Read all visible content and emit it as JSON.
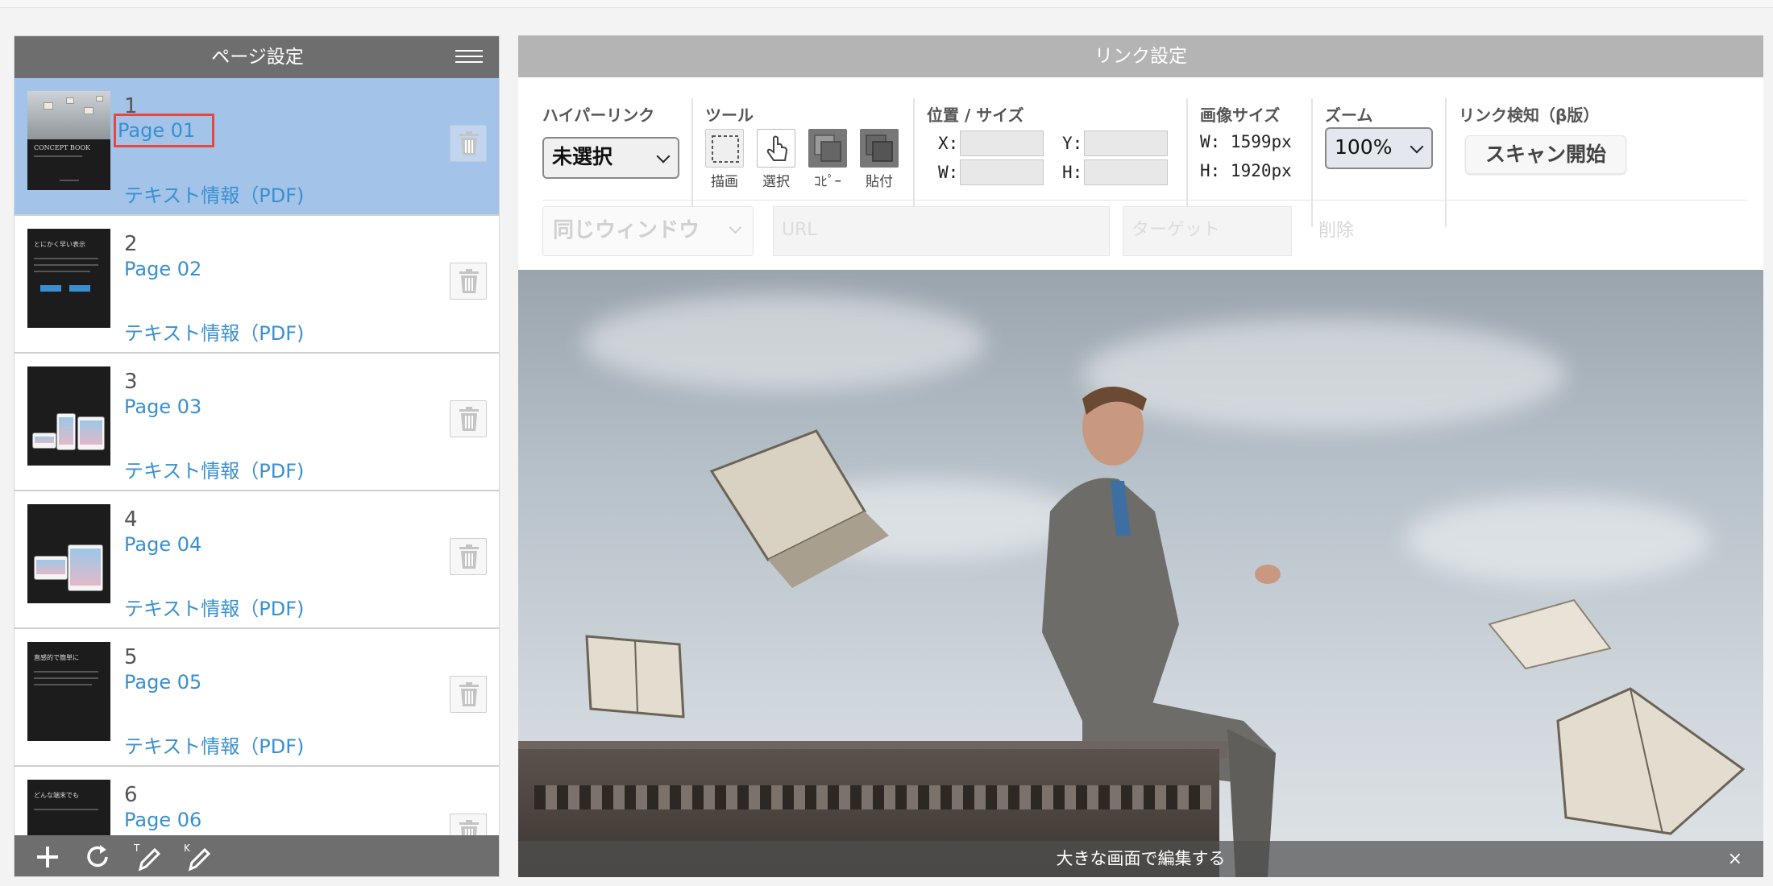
{
  "left_panel": {
    "title": "ページ設定",
    "pages": [
      {
        "number": "1",
        "name": "Page 01",
        "pdf_label": "テキスト情報（PDF)",
        "selected": true
      },
      {
        "number": "2",
        "name": "Page 02",
        "pdf_label": "テキスト情報（PDF)",
        "selected": false
      },
      {
        "number": "3",
        "name": "Page 03",
        "pdf_label": "テキスト情報（PDF)",
        "selected": false
      },
      {
        "number": "4",
        "name": "Page 04",
        "pdf_label": "テキスト情報（PDF)",
        "selected": false
      },
      {
        "number": "5",
        "name": "Page 05",
        "pdf_label": "テキスト情報（PDF)",
        "selected": false
      },
      {
        "number": "6",
        "name": "Page 06",
        "pdf_label": "",
        "selected": false
      }
    ],
    "thumbs": {
      "t1_title": "CONCEPT BOOK",
      "t2_title": "とにかく早い表示",
      "t5_title": "直感的で簡単に",
      "t6_title": "どんな端末でも"
    },
    "footer_icons": [
      "plus-icon",
      "refresh-icon",
      "text-pen-icon",
      "keyword-pen-icon"
    ]
  },
  "right_panel": {
    "title": "リンク設定",
    "hyperlink": {
      "label": "ハイパーリンク",
      "value": "未選択"
    },
    "tools": {
      "label": "ツール",
      "items": [
        {
          "name": "draw",
          "label": "描画"
        },
        {
          "name": "select",
          "label": "選択"
        },
        {
          "name": "copy",
          "label": "ｺﾋﾟｰ"
        },
        {
          "name": "paste",
          "label": "貼付"
        }
      ]
    },
    "position": {
      "label": "位置 / サイズ",
      "x_label": "X:",
      "y_label": "Y:",
      "w_label": "W:",
      "h_label": "H:"
    },
    "image_size": {
      "label": "画像サイズ",
      "w": "W: 1599px",
      "h": "H: 1920px"
    },
    "zoom": {
      "label": "ズーム",
      "value": "100%"
    },
    "link_detect": {
      "label": "リンク検知（β版）",
      "button": "スキャン開始"
    },
    "row2": {
      "window": "同じウィンドウ",
      "url_placeholder": "URL",
      "target_placeholder": "ターゲット",
      "delete": "削除"
    },
    "canvas_footer": "大きな画面で編集する",
    "close": "×"
  }
}
